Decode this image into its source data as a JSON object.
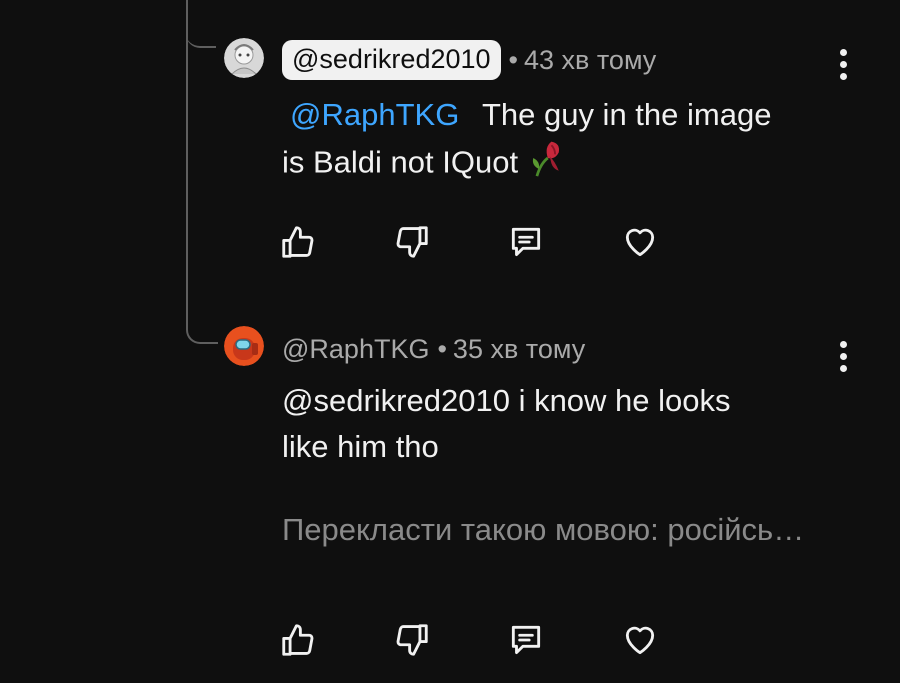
{
  "comments": [
    {
      "author": "@sedrikred2010",
      "author_highlighted": true,
      "separator": "•",
      "time": "43 хв тому",
      "mention": "@RaphTKG",
      "text": "The guy in the image is Baldi not IQuot",
      "text_line1": "The guy in the image",
      "text_line2": "is Baldi not IQuot",
      "emoji": "wilted-flower-emoji",
      "actions": [
        "like-icon",
        "dislike-icon",
        "reply-icon",
        "heart-icon"
      ]
    },
    {
      "author": "@RaphTKG",
      "author_highlighted": false,
      "separator": "•",
      "time": "35 хв тому",
      "mention": "@sedrikred2010",
      "text_line1": "i know he looks",
      "text_line2": "like him tho",
      "translate": "Перекласти такою мовою: російсь…",
      "actions": [
        "like-icon",
        "dislike-icon",
        "reply-icon",
        "heart-icon"
      ]
    }
  ],
  "colors": {
    "background": "#0f0f0f",
    "text": "#f1f1f1",
    "secondary": "#aaaaaa",
    "mention": "#3ea6ff",
    "avatar_orange": "#e8501e"
  }
}
